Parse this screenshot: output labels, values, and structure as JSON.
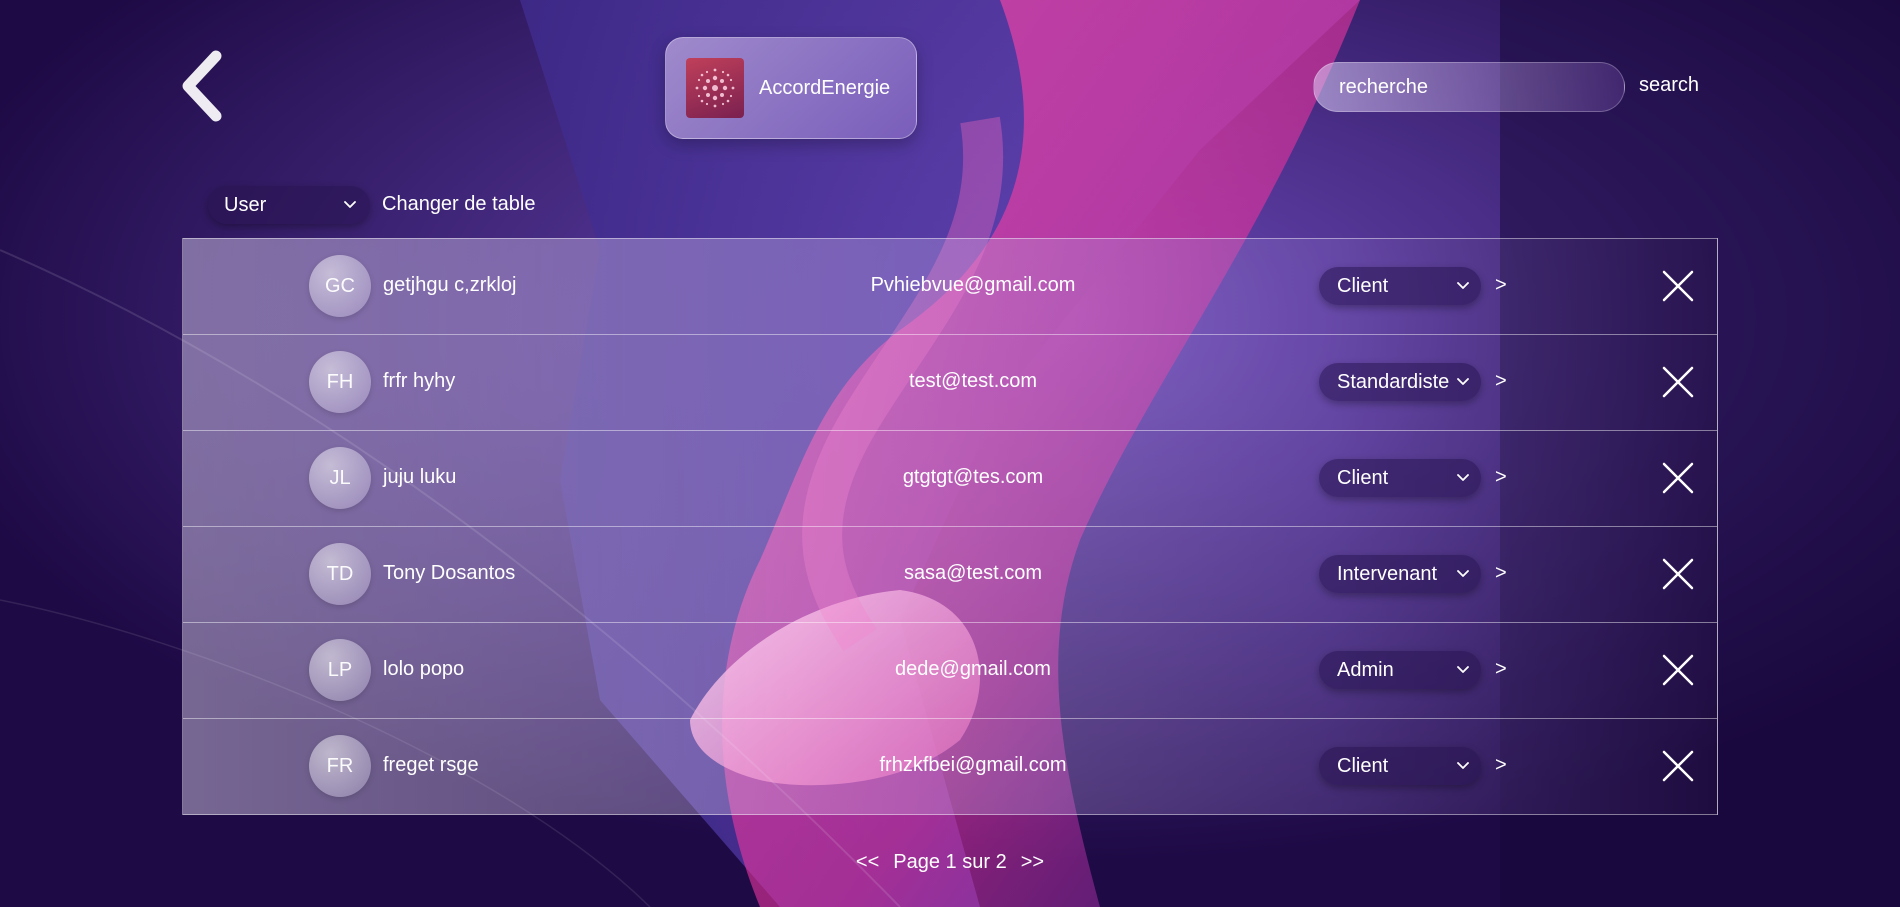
{
  "header": {
    "back_icon": "arrow-left-icon",
    "brand": {
      "name": "AccordEnergie",
      "logo_icon": "globe-dots-logo"
    },
    "search": {
      "placeholder": "recherche",
      "button_label": "search"
    }
  },
  "table_switcher": {
    "selected": "User",
    "label": "Changer de table"
  },
  "rows": [
    {
      "initials": "GC",
      "name": "getjhgu c,zrkloj",
      "email": "Pvhiebvue@gmail.com",
      "role": "Client",
      "open_label": ">"
    },
    {
      "initials": "FH",
      "name": "frfr hyhy",
      "email": "test@test.com",
      "role": "Standardiste",
      "open_label": ">"
    },
    {
      "initials": "JL",
      "name": "juju luku",
      "email": "gtgtgt@tes.com",
      "role": "Client",
      "open_label": ">"
    },
    {
      "initials": "TD",
      "name": "Tony Dosantos",
      "email": "sasa@test.com",
      "role": "Intervenant",
      "open_label": ">"
    },
    {
      "initials": "LP",
      "name": "lolo popo",
      "email": "dede@gmail.com",
      "role": "Admin",
      "open_label": ">"
    },
    {
      "initials": "FR",
      "name": "freget rsge",
      "email": "frhzkfbei@gmail.com",
      "role": "Client",
      "open_label": ">"
    }
  ],
  "pagination": {
    "prev_label": "<<",
    "page_label": "Page 1 sur 2",
    "next_label": ">>"
  },
  "colors": {
    "background": "#1e0a45",
    "accent_pink": "#ff3fa4",
    "accent_violet": "#5a3a9e"
  }
}
